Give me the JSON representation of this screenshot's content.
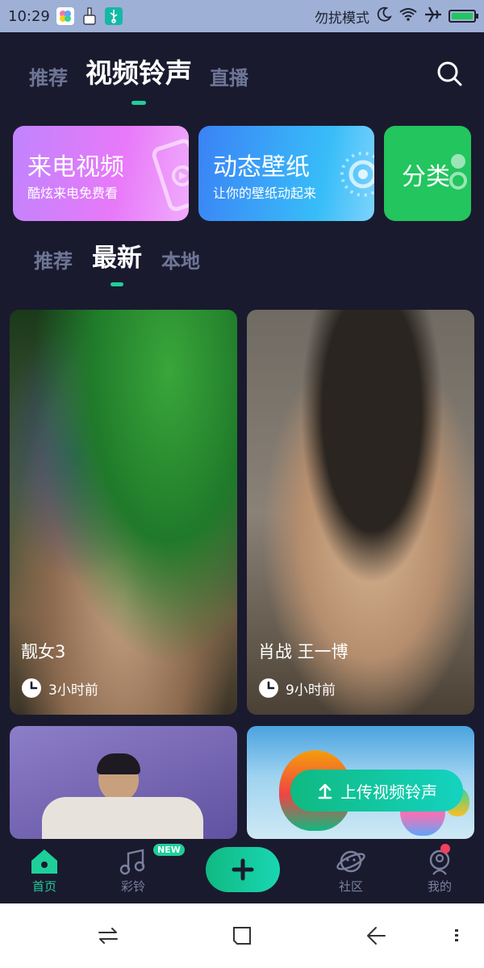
{
  "status_bar": {
    "time": "10:29",
    "dnd_label": "勿扰模式"
  },
  "top_tabs": [
    {
      "label": "推荐",
      "active": false
    },
    {
      "label": "视频铃声",
      "active": true
    },
    {
      "label": "直播",
      "active": false
    }
  ],
  "banners": [
    {
      "title": "来电视频",
      "subtitle": "酷炫来电免费看"
    },
    {
      "title": "动态壁纸",
      "subtitle": "让你的壁纸动起来"
    },
    {
      "title": "分类",
      "subtitle": ""
    }
  ],
  "sub_tabs": [
    {
      "label": "推荐",
      "active": false
    },
    {
      "label": "最新",
      "active": true
    },
    {
      "label": "本地",
      "active": false
    }
  ],
  "videos": [
    {
      "title": "靓女3",
      "time": "3小时前"
    },
    {
      "title": "肖战 王一博",
      "time": "9小时前"
    }
  ],
  "upload_label": "上传视频铃声",
  "bottom_nav": [
    {
      "label": "首页",
      "active": true
    },
    {
      "label": "彩铃",
      "active": false,
      "badge": "NEW"
    },
    {
      "label": "社区",
      "active": false
    },
    {
      "label": "我的",
      "active": false
    }
  ],
  "colors": {
    "accent": "#1ecf9a",
    "background": "#1a1a2e",
    "inactive_tab": "#6e7696"
  }
}
